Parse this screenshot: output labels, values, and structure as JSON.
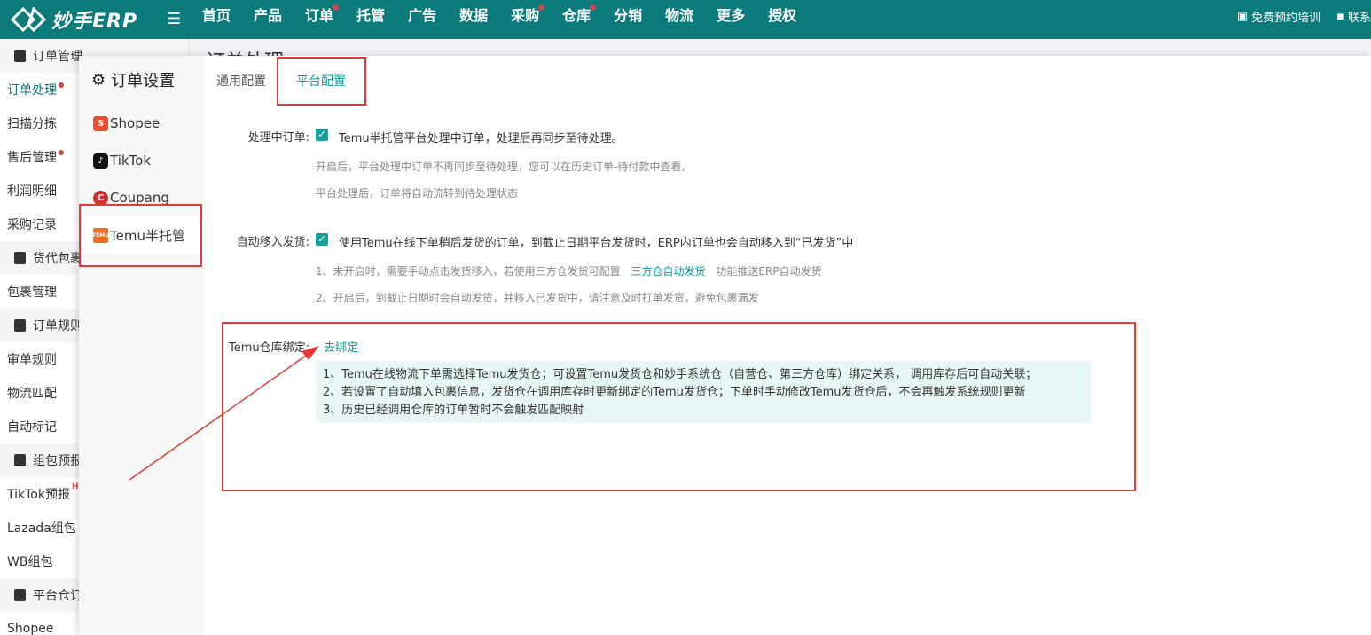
{
  "brand": {
    "name": "妙手ERP"
  },
  "nav": [
    {
      "label": "首页",
      "dot": false
    },
    {
      "label": "产品",
      "dot": false
    },
    {
      "label": "订单",
      "dot": true
    },
    {
      "label": "托管",
      "dot": false
    },
    {
      "label": "广告",
      "dot": false
    },
    {
      "label": "数据",
      "dot": false
    },
    {
      "label": "采购",
      "dot": true
    },
    {
      "label": "仓库",
      "dot": true
    },
    {
      "label": "分销",
      "dot": false
    },
    {
      "label": "物流",
      "dot": false
    },
    {
      "label": "更多",
      "dot": false
    },
    {
      "label": "授权",
      "dot": false
    }
  ],
  "top_right": {
    "training": "免费预约培训",
    "contact": "联系"
  },
  "sidebar": {
    "groups": [
      {
        "label": "订单管理",
        "items": [
          "订单处理",
          "扫描分拣",
          "售后管理",
          "利润明细",
          "采购记录"
        ]
      },
      {
        "label": "货代包裹",
        "items": [
          "包裹管理"
        ]
      },
      {
        "label": "订单规则",
        "items": [
          "审单规则",
          "物流匹配",
          "自动标记"
        ]
      },
      {
        "label": "组包预报",
        "items": [
          "TikTok预报",
          "Lazada组包",
          "WB组包"
        ]
      },
      {
        "label": "平台仓订",
        "items": [
          "Shopee"
        ]
      }
    ],
    "hot_badge": "HOT"
  },
  "behind_title": "订单处理",
  "modal": {
    "title": "订单设置",
    "platforms": [
      "Shopee",
      "TikTok",
      "Coupang",
      "Temu半托管"
    ],
    "tabs": [
      "通用配置",
      "平台配置"
    ],
    "settings": {
      "processing_label": "处理中订单:",
      "processing_text": "Temu半托管平台处理中订单，处理后再同步至待处理。",
      "processing_hint1": "开启后，平台处理中订单不再同步至待处理，您可以在历史订单-待付款中查看。",
      "processing_hint2": "平台处理后，订单将自动流转到待处理状态",
      "auto_ship_label": "自动移入发货:",
      "auto_ship_text": "使用Temu在线下单稍后发货的订单，到截止日期平台发货时，ERP内订单也会自动移入到“已发货”中",
      "auto_ship_hint1_a": "1、未开启时，需要手动点击发货移入，若使用三方仓发货可配置",
      "auto_ship_hint1_link": "三方仓自动发货",
      "auto_ship_hint1_b": "功能推送ERP自动发货",
      "auto_ship_hint2": "2、开启后，到截止日期时会自动发货，并移入已发货中，请注意及时打单发货，避免包裹漏发",
      "warehouse_label": "Temu仓库绑定:",
      "warehouse_link": "去绑定",
      "info": [
        "1、Temu在线物流下单需选择Temu发货仓；可设置Temu发货仓和妙手系统仓（自营仓、第三方仓库）绑定关系， 调用库存后可自动关联；",
        "2、若设置了自动填入包裹信息，发货仓在调用库存时更新绑定的Temu发货仓；下单时手动修改Temu发货仓后，不会再触发系统规则更新",
        "3、历史已经调用仓库的订单暂时不会触发匹配映射"
      ]
    }
  },
  "colors": {
    "primary": "#0b7b7b",
    "accent": "#0b9b9b",
    "annotation": "#e53935"
  }
}
